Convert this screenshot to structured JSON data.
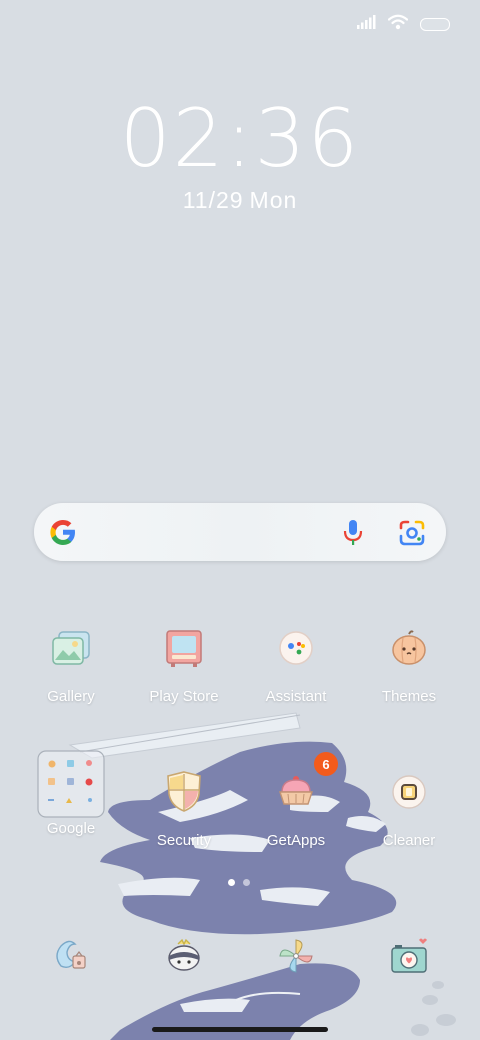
{
  "clock": {
    "time": "02:36",
    "date": "11/29",
    "weekday": "Mon"
  },
  "search": {
    "label": "Google search bar"
  },
  "apps_row1": [
    {
      "label": "Gallery"
    },
    {
      "label": "Play Store"
    },
    {
      "label": "Assistant"
    },
    {
      "label": "Themes"
    }
  ],
  "apps_row2": [
    {
      "label": "Google"
    },
    {
      "label": "Security"
    },
    {
      "label": "GetApps",
      "badge": "6"
    },
    {
      "label": "Cleaner"
    }
  ],
  "dock": [
    {
      "icon": "browser-icon"
    },
    {
      "icon": "messages-icon"
    },
    {
      "icon": "pinwheel-icon"
    },
    {
      "icon": "camera-icon"
    }
  ],
  "page_indicator": {
    "current": 1,
    "total": 2
  },
  "colors": {
    "background": "#d8dde3",
    "badge": "#f35b1c",
    "label_text": "#ffffff"
  }
}
